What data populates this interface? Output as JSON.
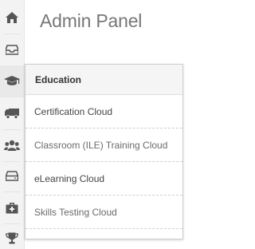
{
  "header": {
    "title": "Admin Panel"
  },
  "sidebar": {
    "items": [
      {
        "icon": "home-icon"
      },
      {
        "icon": "inbox-icon"
      },
      {
        "icon": "graduation-cap-icon"
      },
      {
        "icon": "truck-icon"
      },
      {
        "icon": "users-icon"
      },
      {
        "icon": "hard-drive-icon"
      },
      {
        "icon": "medkit-icon"
      },
      {
        "icon": "trophy-icon"
      }
    ],
    "icon_color": "#555555"
  },
  "dropdown": {
    "header": "Education",
    "items": [
      {
        "label": "Certification Cloud"
      },
      {
        "label": "Classroom (ILE) Training Cloud"
      },
      {
        "label": "eLearning Cloud"
      },
      {
        "label": "Skills Testing Cloud"
      }
    ]
  }
}
